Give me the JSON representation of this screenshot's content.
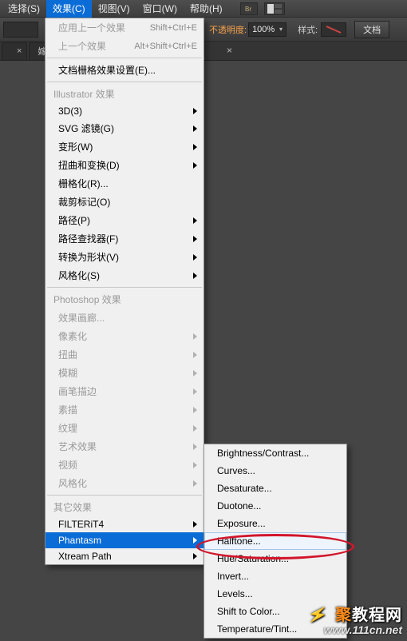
{
  "menubar": {
    "select": "选择(S)",
    "effects": "效果(C)",
    "view": "视图(V)",
    "window": "窗口(W)",
    "help": "帮助(H)"
  },
  "optbar": {
    "opacity_label": "不透明度:",
    "opacity_value": "100%",
    "style_label": "样式:",
    "doc_btn": "文档"
  },
  "tabs": {
    "t1": "",
    "t2": "嫁",
    "t2_state": "×"
  },
  "menu": {
    "apply_last": "应用上一个效果",
    "apply_last_sc": "Shift+Ctrl+E",
    "last_effect": "上一个效果",
    "last_effect_sc": "Alt+Shift+Ctrl+E",
    "doc_raster": "文档栅格效果设置(E)...",
    "sec_illustrator": "Illustrator 效果",
    "i3d": "3D(3)",
    "svg": "SVG 滤镜(G)",
    "deform": "变形(W)",
    "distort": "扭曲和变换(D)",
    "rasterize": "栅格化(R)...",
    "cropmarks": "裁剪标记(O)",
    "path": "路径(P)",
    "pathfinder": "路径查找器(F)",
    "toShape": "转换为形状(V)",
    "stylize": "风格化(S)",
    "sec_ps": "Photoshop 效果",
    "ps_gallery": "效果画廊...",
    "ps_pixelate": "像素化",
    "ps_distort": "扭曲",
    "ps_blur": "模糊",
    "ps_brush": "画笔描边",
    "ps_sketch": "素描",
    "ps_texture": "纹理",
    "ps_artistic": "艺术效果",
    "ps_video": "视频",
    "ps_stylize": "风格化",
    "sec_other": "其它效果",
    "filterit": "FILTERiT4",
    "phantasm": "Phantasm",
    "xtream": "Xtream Path"
  },
  "submenu": {
    "bc": "Brightness/Contrast...",
    "curves": "Curves...",
    "desat": "Desaturate...",
    "duotone": "Duotone...",
    "exposure": "Exposure...",
    "halftone": "Halftone...",
    "huesat": "Hue/Saturation...",
    "invert": "Invert...",
    "levels": "Levels...",
    "shift": "Shift to Color...",
    "temp": "Temperature/Tint..."
  },
  "watermark": {
    "line1a": "聚",
    "line1b": "教程网",
    "line2": "www.111cn.net"
  }
}
